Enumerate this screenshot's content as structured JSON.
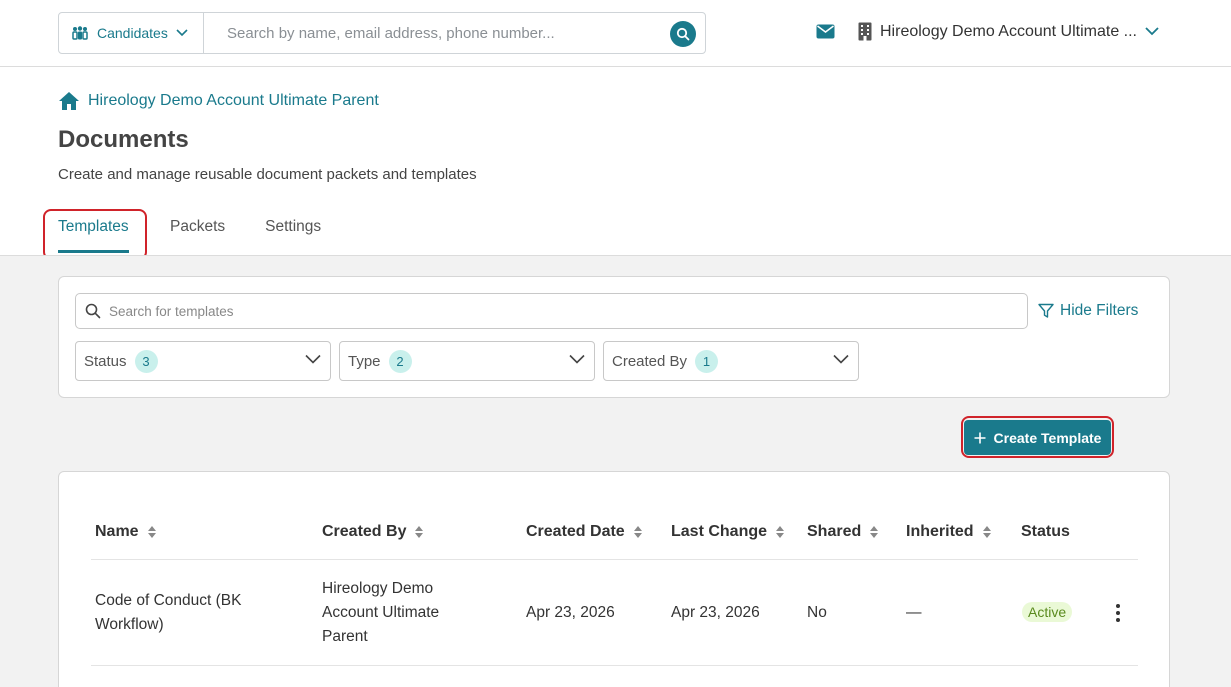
{
  "header": {
    "scope_label": "Candidates",
    "search_placeholder": "Search by name, email address, phone number...",
    "account_name": "Hireology Demo Account Ultimate ..."
  },
  "breadcrumb": {
    "label": "Hireology Demo Account Ultimate Parent"
  },
  "page": {
    "title": "Documents",
    "subtitle": "Create and manage reusable document packets and templates"
  },
  "tabs": [
    {
      "label": "Templates",
      "active": true
    },
    {
      "label": "Packets",
      "active": false
    },
    {
      "label": "Settings",
      "active": false
    }
  ],
  "filters": {
    "search_placeholder": "Search for templates",
    "hide_filters_label": "Hide Filters",
    "items": [
      {
        "label": "Status",
        "count": "3"
      },
      {
        "label": "Type",
        "count": "2"
      },
      {
        "label": "Created By",
        "count": "1"
      }
    ]
  },
  "create_button_label": "Create Template",
  "table": {
    "columns": [
      "Name",
      "Created By",
      "Created Date",
      "Last Change",
      "Shared",
      "Inherited",
      "Status"
    ],
    "rows": [
      {
        "name": [
          "Code of Conduct (BK",
          "Workflow)"
        ],
        "created_by": [
          "Hireology Demo",
          "Account Ultimate",
          "Parent"
        ],
        "created_date": "Apr 23, 2026",
        "last_change": "Apr 23, 2026",
        "shared": "No",
        "inherited": "—",
        "status": "Active"
      }
    ]
  },
  "colors": {
    "accent": "#1a7a8c",
    "highlight": "#d0232a",
    "badge_bg": "#c9f0ec",
    "status_bg": "#eaf9d6"
  },
  "icons": [
    "candidates-icon",
    "chevron-down-icon",
    "search-icon",
    "mail-icon",
    "building-icon",
    "home-icon",
    "filter-icon",
    "plus-icon",
    "sort-icon",
    "kebab-menu-icon"
  ]
}
